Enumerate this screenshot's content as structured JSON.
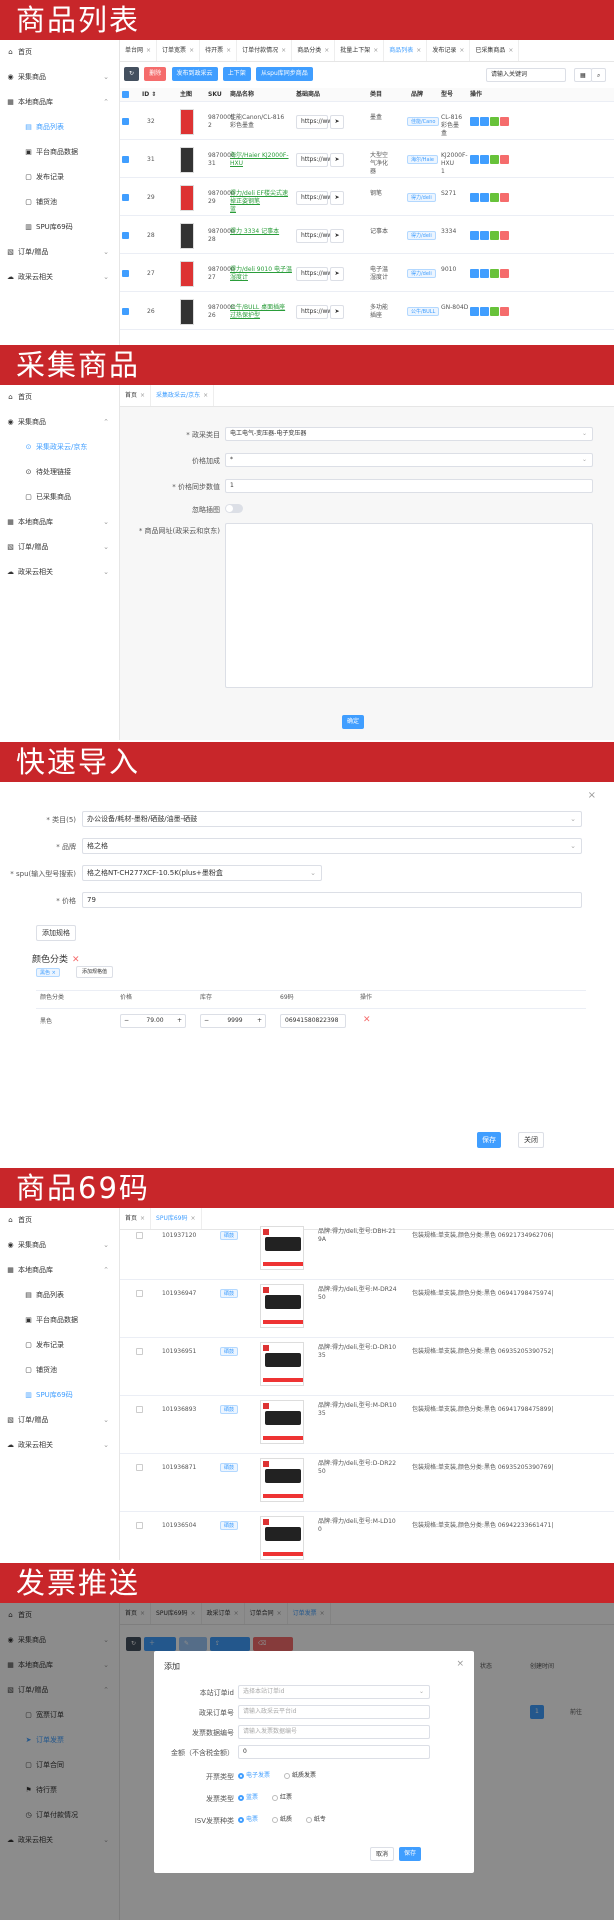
{
  "banners": {
    "product_list": "商品列表",
    "collect": "采集商品",
    "quick_import": "快速导入",
    "code69": "商品69码",
    "invoice": "发票推送"
  },
  "sidebar1": {
    "home": "首页",
    "collect": "采集商品",
    "local_lib": "本地商品库",
    "product_list": "商品列表",
    "platform_data": "平台商品数据",
    "publish_log": "发布记录",
    "shelf": "铺货池",
    "spu69": "SPU库69码",
    "orders": "订单/赠品",
    "gov": "政采云相关"
  },
  "tabs1": [
    "单台网",
    "订单宽票",
    "待开票",
    "订单付款情况",
    "商品分类",
    "批量上下架",
    "商品列表",
    "发布记录",
    "已采集商品"
  ],
  "toolbar1": {
    "delete": "删除",
    "publish_gov": "发布到政采云",
    "shelf": "上下架",
    "spu_match": "从spu库同步商品",
    "search_placeholder": "请输入关键词"
  },
  "table1": {
    "headers": [
      "ID ⇕",
      "主图",
      "SKU",
      "商品名称",
      "基础商品",
      "类目",
      "品牌",
      "型号",
      "操作"
    ],
    "rows": [
      {
        "id": "32",
        "sku": "9870005\n2",
        "name": "佳能Canon/CL-816 彩色墨盒",
        "url": "https://ww",
        "cat": "墨盒",
        "brand": "佳能/Cano",
        "model": "CL-816 彩色墨\n盒",
        "link": false
      },
      {
        "id": "31",
        "sku": "9870000\n31",
        "name": "海尔/Haier KJ2000F-HXU",
        "url": "https://ww",
        "cat": "大型空\n气净化\n器",
        "brand": "海尔/Haie",
        "model": "KJ2000F-HXU\n1",
        "link": true
      },
      {
        "id": "29",
        "sku": "9870000\n29",
        "name": "得力/deli EF楼尖式速掉正姿钢笔\n蓝",
        "url": "https://ww",
        "cat": "钢笔",
        "brand": "得力/deli",
        "model": "S271",
        "link": true
      },
      {
        "id": "28",
        "sku": "9870000\n28",
        "name": "得力 3334 记事本",
        "url": "https://ww",
        "cat": "记事本",
        "brand": "得力/deli",
        "model": "3334",
        "link": true
      },
      {
        "id": "27",
        "sku": "9870000\n27",
        "name": "得力/deli 9010 电子温湿度计",
        "url": "https://ww",
        "cat": "电子温\n湿度计",
        "brand": "得力/deli",
        "model": "9010",
        "link": true
      },
      {
        "id": "26",
        "sku": "9870000\n26",
        "name": "公牛/BULL 桌面插座 过热保护型",
        "url": "https://ww",
        "cat": "多功能\n插座",
        "brand": "公牛/BULL",
        "model": "GN-804D",
        "link": true
      }
    ]
  },
  "sidebar2": {
    "home": "首页",
    "collect": "采集商品",
    "collect_gov": "采集政采云/京东",
    "pending": "待处理链接",
    "collected": "已采集商品",
    "local_lib": "本地商品库",
    "orders": "订单/赠品",
    "gov": "政采云相关"
  },
  "tabs2": [
    "首页",
    "采集政采云/京东"
  ],
  "form2": {
    "cat_label": "* 政采类目",
    "cat_value": "电工电气-变压器-电子变压器",
    "price_label": "价格加成",
    "price_value": "*",
    "count_label": "* 价格同步数值",
    "count_value": "1",
    "toggle_label": "忽略插图",
    "url_label": "* 商品网址(政采云和京东)",
    "confirm": "确定"
  },
  "form3": {
    "cat_label": "* 类目(5)",
    "cat_value": "办公设备/耗材-墨粉/硒鼓/油墨-硒鼓",
    "brand_label": "* 品牌",
    "brand_value": "格之格",
    "spu_label": "* spu(输入型号搜索)",
    "spu_value": "格之格NT-CH277XCF-10.5K(plus+墨粉盒",
    "price_label": "* 价格",
    "price_value": "79",
    "add_spec": "添加规格",
    "color_title": "颜色分类",
    "color_tag": "黑色",
    "add_value": "添加规格值",
    "headers": [
      "颜色分类",
      "价格",
      "库存",
      "69码",
      "操作"
    ],
    "row": {
      "color": "黑色",
      "price": "79.00",
      "stock": "9999",
      "code": "06941580822398"
    },
    "save": "保存",
    "close": "关闭"
  },
  "sidebar4": {
    "home": "首页",
    "collect": "采集商品",
    "local_lib": "本地商品库",
    "product_list": "商品列表",
    "platform_data": "平台商品数据",
    "publish_log": "发布记录",
    "shelf": "铺货池",
    "spu69": "SPU库69码",
    "orders": "订单/赠品",
    "gov": "政采云相关"
  },
  "tabs4": [
    "首页",
    "SPU库69码"
  ],
  "table4": [
    {
      "id": "101937120",
      "tag": "硒鼓",
      "desc": "品牌:得力/deli,型号:DBH-21\n9A",
      "spec": "包装规格:单支装,颜色分类:黑色 06921734962706|"
    },
    {
      "id": "101936947",
      "tag": "硒鼓",
      "desc": "品牌:得力/deli,型号:M-DR24\n50",
      "spec": "包装规格:单支装,颜色分类:黑色 06941798475974|"
    },
    {
      "id": "101936951",
      "tag": "硒鼓",
      "desc": "品牌:得力/deli,型号:D-DR10\n35",
      "spec": "包装规格:单支装,颜色分类:黑色 06935205390752|"
    },
    {
      "id": "101936893",
      "tag": "硒鼓",
      "desc": "品牌:得力/deli,型号:M-DR10\n35",
      "spec": "包装规格:单支装,颜色分类:黑色 06941798475899|"
    },
    {
      "id": "101936871",
      "tag": "硒鼓",
      "desc": "品牌:得力/deli,型号:D-DR22\n50",
      "spec": "包装规格:单支装,颜色分类:黑色 06935205390769|"
    },
    {
      "id": "101936504",
      "tag": "硒鼓",
      "desc": "品牌:得力/deli,型号:M-LD10\n0",
      "spec": "包装规格:单支装,颜色分类:黑色 06942233661471|"
    }
  ],
  "sidebar5": {
    "home": "首页",
    "collect": "采集商品",
    "local_lib": "本地商品库",
    "orders": "订单/赠品",
    "order_ticket": "宽票订单",
    "invoice_push": "订单发票",
    "order_contract": "订单合同",
    "gift": "待行票",
    "pay_status": "订单付款情况",
    "gov": "政采云相关"
  },
  "tabs5": [
    "首页",
    "SPU库69码",
    "政采订单",
    "订单合同",
    "订单发票"
  ],
  "dialog": {
    "title": "添加",
    "order_label": "本站订单id",
    "order_ph": "选择本站订单id",
    "gov_label": "政采订单号",
    "gov_ph": "请输入政采云平台id",
    "inv_label": "发票数据编号",
    "inv_ph": "请输入发票数据编号",
    "amount_label": "金额（不含税金额）",
    "amount_value": "0",
    "type_label": "开票类型",
    "type_opts": [
      "电子发票",
      "纸质发票"
    ],
    "color_label": "发票类型",
    "color_opts": [
      "蓝票",
      "红票"
    ],
    "tax_label": "ISV发票种类",
    "tax_opts": [
      "电票",
      "纸质",
      "纸专"
    ],
    "cancel": "取消",
    "ok": "保存"
  },
  "bg5": {
    "status": "状态",
    "created": "创建时间",
    "page": "1",
    "goto": "前往"
  }
}
